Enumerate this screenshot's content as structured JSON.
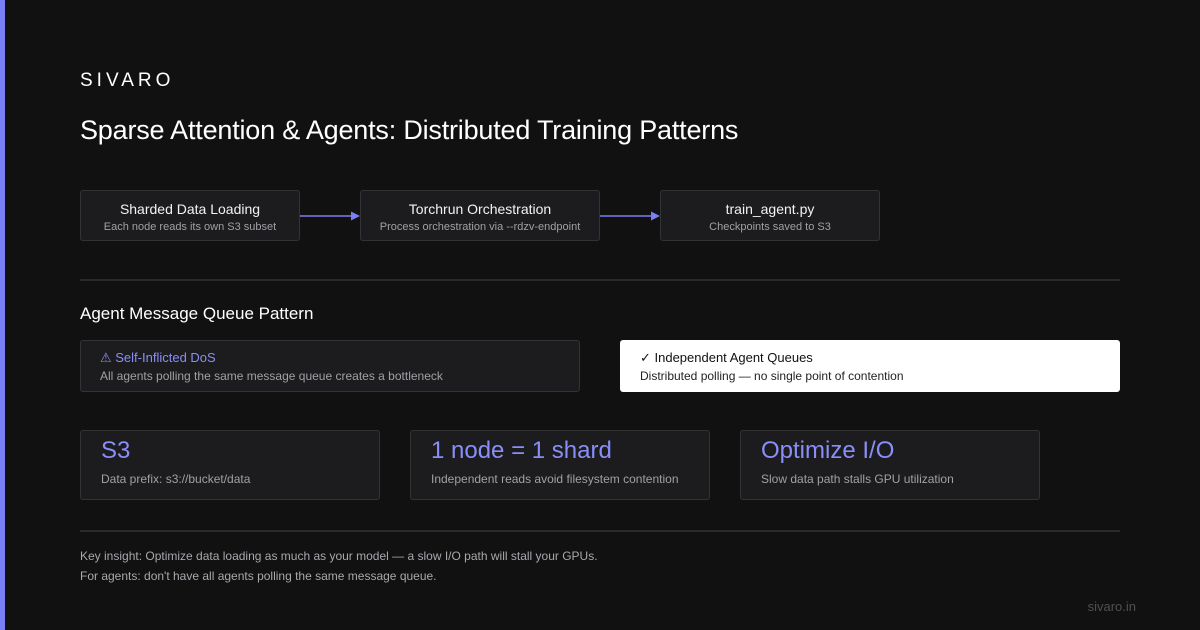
{
  "brand": "SIVARO",
  "title": "Sparse Attention & Agents: Distributed Training Patterns",
  "pipeline": [
    {
      "title": "Sharded Data Loading",
      "subtitle": "Each node reads its own S3 subset"
    },
    {
      "title": "Torchrun Orchestration",
      "subtitle": "Process orchestration via --rdzv-endpoint"
    },
    {
      "title": "train_agent.py",
      "subtitle": "Checkpoints saved to S3"
    }
  ],
  "queue_section": {
    "title": "Agent Message Queue Pattern",
    "bad": {
      "title": "⚠ Self-Inflicted DoS",
      "description": "All agents polling the same message queue creates a bottleneck"
    },
    "good": {
      "title": "✓ Independent Agent Queues",
      "description": "Distributed polling — no single point of contention"
    }
  },
  "stats": [
    {
      "value": "S3",
      "description": "Data prefix: s3://bucket/data"
    },
    {
      "value": "1 node = 1 shard",
      "description": "Independent reads avoid filesystem contention"
    },
    {
      "value": "Optimize I/O",
      "description": "Slow data path stalls GPU utilization"
    }
  ],
  "footer": {
    "lines": [
      "Key insight: Optimize data loading as much as your model — a slow I/O path will stall your GPUs.",
      "For agents: don't have all agents polling the same message queue."
    ],
    "site": "sivaro.in"
  },
  "colors": {
    "background": "#111111",
    "accent": "#7b7ff5",
    "card": "#1c1c1e",
    "highlight_card": "#ffffff"
  }
}
